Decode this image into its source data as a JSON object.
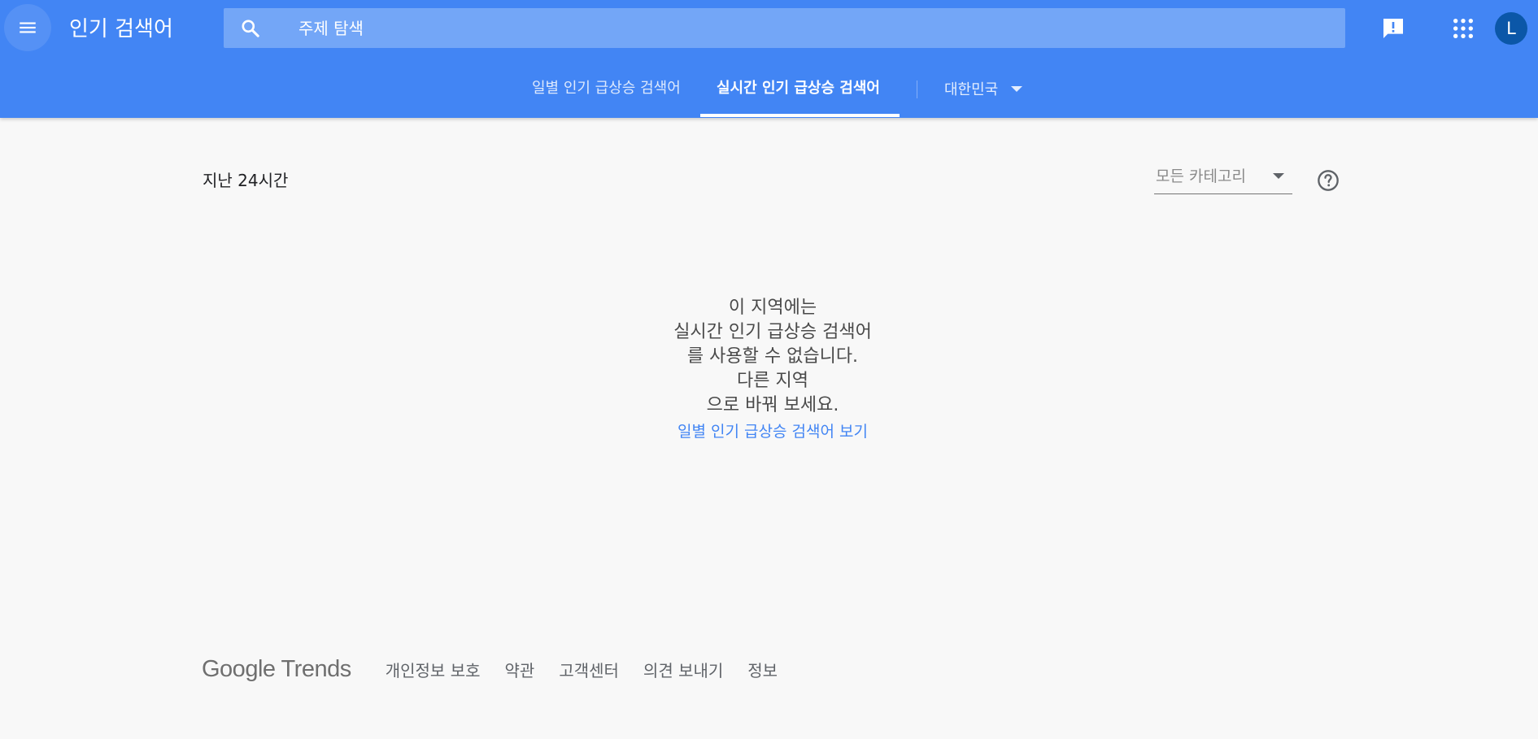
{
  "header": {
    "title": "인기 검색어",
    "menu_icon": "hamburger-menu-icon",
    "search": {
      "placeholder": "주제 탐색",
      "value": "",
      "icon": "search-icon"
    },
    "feedback_icon": "feedback-icon",
    "apps_icon": "apps-grid-icon",
    "avatar_letter": "L",
    "accent_color": "#4285f4"
  },
  "tabs": [
    {
      "label": "일별 인기 급상승 검색어",
      "active": false
    },
    {
      "label": "실시간 인기 급상승 검색어",
      "active": true
    }
  ],
  "region": {
    "selected": "대한민국"
  },
  "filters": {
    "time_range": "지난 24시간",
    "category": "모든 카테고리",
    "help_icon": "help-icon"
  },
  "empty_state": {
    "lines": [
      "이 지역에는",
      "실시간 인기 급상승 검색어",
      "를 사용할 수 없습니다.",
      "다른 지역",
      "으로 바꿔 보세요."
    ],
    "link_label": "일별 인기 급상승 검색어 보기",
    "link_color": "#4285f4"
  },
  "footer": {
    "logo_text": "Google Trends",
    "links": [
      "개인정보 보호",
      "약관",
      "고객센터",
      "의견 보내기",
      "정보"
    ]
  }
}
